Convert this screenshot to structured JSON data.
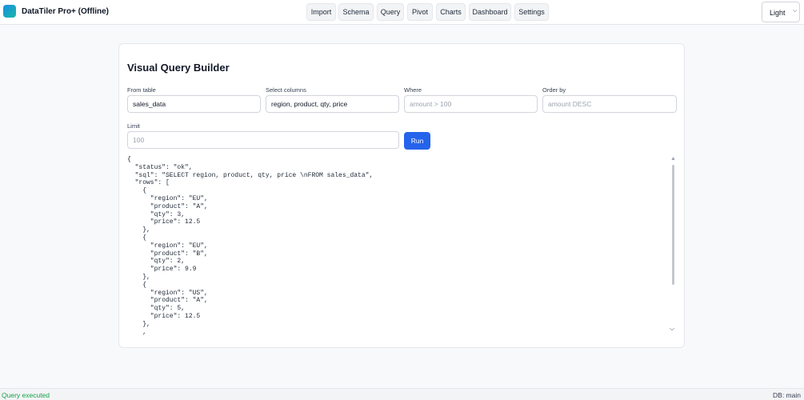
{
  "app": {
    "title": "DataTiler Pro+ (Offline)",
    "logo_icon": "app-logo-icon",
    "accent_color": "#2563eb"
  },
  "nav": {
    "items": [
      {
        "label": "Import"
      },
      {
        "label": "Schema"
      },
      {
        "label": "Query"
      },
      {
        "label": "Pivot"
      },
      {
        "label": "Charts"
      },
      {
        "label": "Dashboard"
      },
      {
        "label": "Settings"
      }
    ]
  },
  "theme": {
    "selected": "Light",
    "icon": "chevron-down-icon"
  },
  "query_builder": {
    "title": "Visual Query Builder",
    "from_table": {
      "label": "From table",
      "value": "sales_data",
      "placeholder": ""
    },
    "select_columns": {
      "label": "Select columns",
      "value": "region, product, qty, price",
      "placeholder": ""
    },
    "where": {
      "label": "Where",
      "value": "",
      "placeholder": "amount > 100"
    },
    "order_by": {
      "label": "Order by",
      "value": "",
      "placeholder": "amount DESC"
    },
    "limit": {
      "label": "Limit",
      "value": "",
      "placeholder": "100"
    },
    "run_label": "Run",
    "output": "{\n  \"status\": \"ok\",\n  \"sql\": \"SELECT region, product, qty, price \\nFROM sales_data\",\n  \"rows\": [\n    {\n      \"region\": \"EU\",\n      \"product\": \"A\",\n      \"qty\": 3,\n      \"price\": 12.5\n    },\n    {\n      \"region\": \"EU\",\n      \"product\": \"B\",\n      \"qty\": 2,\n      \"price\": 9.9\n    },\n    {\n      \"region\": \"US\",\n      \"product\": \"A\",\n      \"qty\": 5,\n      \"price\": 12.5\n    },\n    ,"
  },
  "status": {
    "message": "Query executed",
    "message_color": "#16a34a",
    "db": "DB: main"
  }
}
